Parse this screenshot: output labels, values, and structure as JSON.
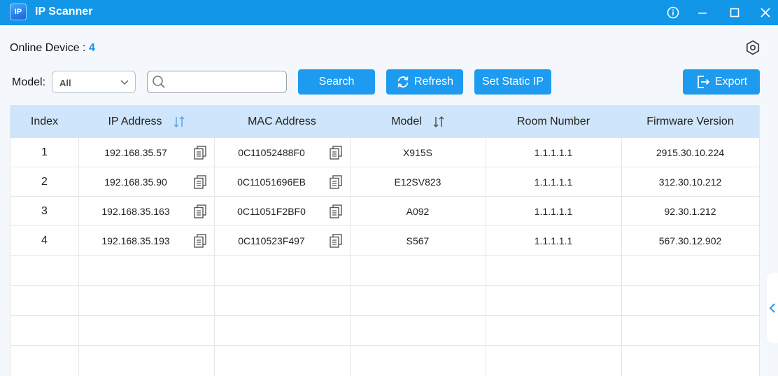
{
  "app": {
    "title": "IP Scanner",
    "logo_text": "IP"
  },
  "window_controls": [
    "info-icon",
    "minimize-icon",
    "maximize-icon",
    "close-icon"
  ],
  "online": {
    "label": "Online Device : ",
    "count": "4"
  },
  "filter": {
    "model_label": "Model:",
    "model_value": "All",
    "search_value": "",
    "search_placeholder": ""
  },
  "buttons": {
    "search": "Search",
    "refresh": "Refresh",
    "set_static_ip": "Set Static IP",
    "export": "Export"
  },
  "table": {
    "columns": [
      "Index",
      "IP Address",
      "MAC Address",
      "Model",
      "Room Number",
      "Firmware Version"
    ],
    "rows": [
      {
        "index": "1",
        "ip": "192.168.35.57",
        "mac": "0C11052488F0",
        "model": "X915S",
        "room": "1.1.1.1.1",
        "firmware": "2915.30.10.224"
      },
      {
        "index": "2",
        "ip": "192.168.35.90",
        "mac": "0C11051696EB",
        "model": "E12SV823",
        "room": "1.1.1.1.1",
        "firmware": "312.30.10.212"
      },
      {
        "index": "3",
        "ip": "192.168.35.163",
        "mac": "0C11051F2BF0",
        "model": "A092",
        "room": "1.1.1.1.1",
        "firmware": "92.30.1.212"
      },
      {
        "index": "4",
        "ip": "192.168.35.193",
        "mac": "0C110523F497",
        "model": "S567",
        "room": "1.1.1.1.1",
        "firmware": "567.30.12.902"
      }
    ],
    "empty_rows": 4
  },
  "colors": {
    "accent": "#1d9bf0",
    "titlebar": "#1296e8",
    "header_bg": "#cfe5fb"
  }
}
